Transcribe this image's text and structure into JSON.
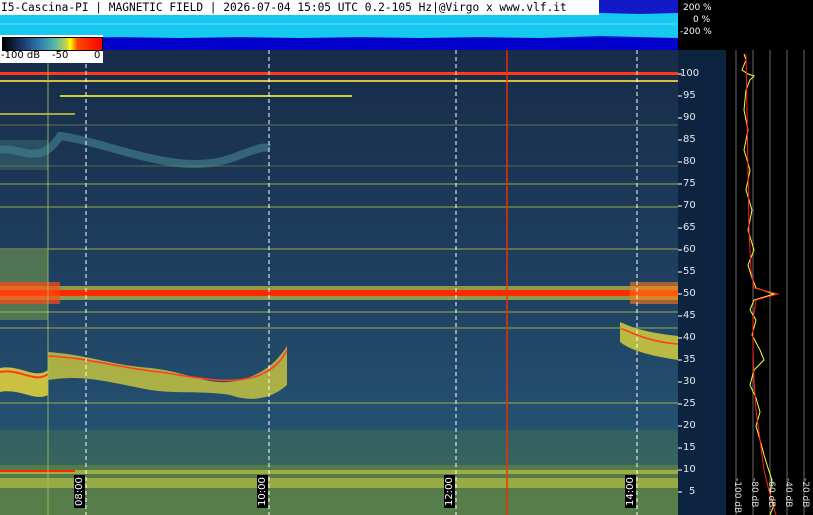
{
  "title": "I5-Cascina-PI | MAGNETIC FIELD | 2026-07-04 15:05 UTC 0.2-105 Hz|@Virgo x www.vlf.it",
  "amplitude_strip": {
    "labels": [
      "200 %",
      "0 %",
      "-200 %"
    ]
  },
  "colorbar": {
    "labels": [
      "-100 dB",
      "-50",
      "0"
    ],
    "colors": [
      "#000000",
      "#1e3a6e",
      "#2f7fb0",
      "#4fb8a8",
      "#c8d24a",
      "#ffff00",
      "#ff0000"
    ]
  },
  "frequency_axis": {
    "unit": "Hz",
    "ticks": [
      "100",
      "95",
      "90",
      "85",
      "80",
      "75",
      "70",
      "65",
      "60",
      "55",
      "50",
      "45",
      "40",
      "35",
      "30",
      "25",
      "20",
      "15",
      "10",
      "5"
    ],
    "range": [
      0,
      105
    ]
  },
  "time_axis": {
    "ticks": [
      "08:00",
      "10:00",
      "12:00",
      "14:00"
    ]
  },
  "profile_axis": {
    "ticks": [
      "-100 dB",
      "-80 dB",
      "-60 dB",
      "-40 dB",
      "-20 dB"
    ]
  },
  "colors": {
    "background": "#1d3a55",
    "mains_line": "#ff2a00",
    "grid": "#ffffff",
    "profile_trace": "#ffff33",
    "profile_mean": "#ff2020",
    "amp_fill": "#16c6ee",
    "amp_base": "#0000dd"
  }
}
